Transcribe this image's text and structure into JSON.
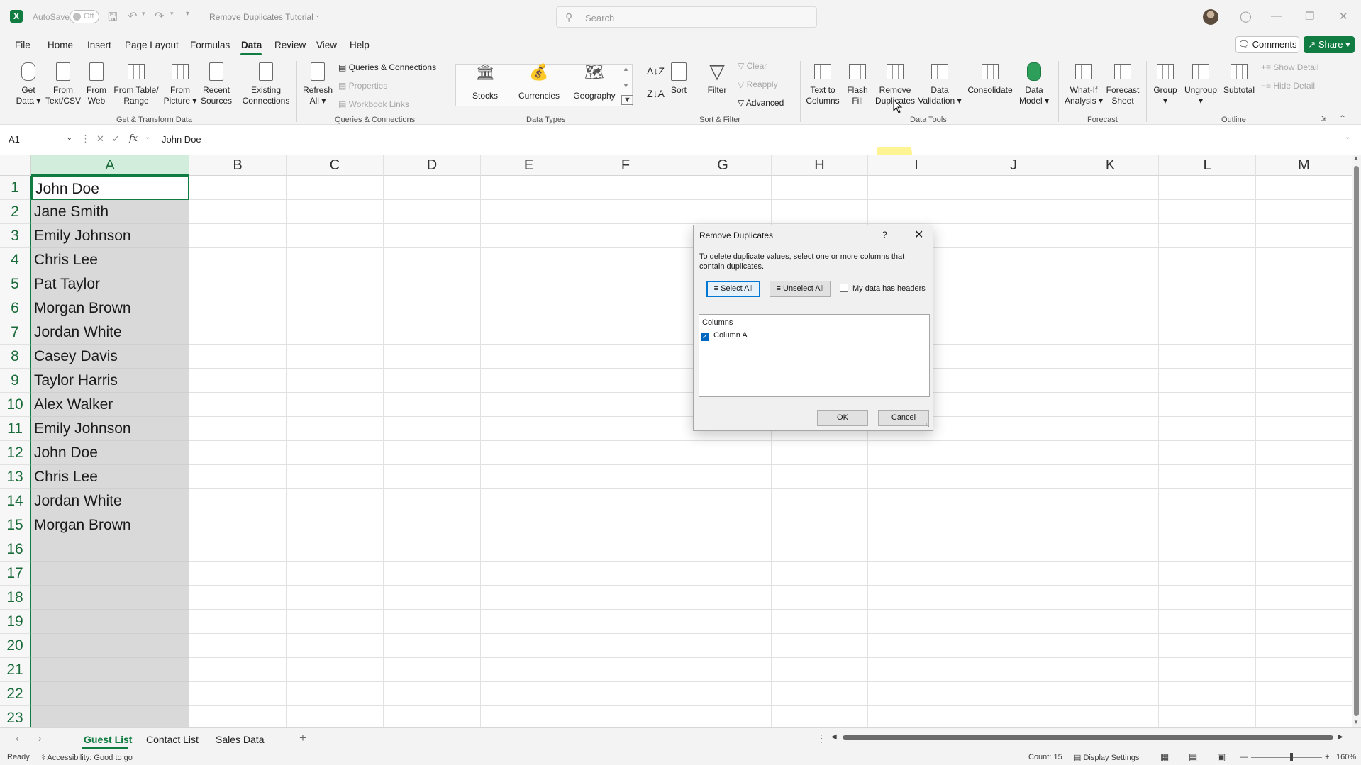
{
  "titlebar": {
    "autosave_label": "AutoSave",
    "autosave_state": "Off",
    "document_title": "Remove Duplicates Tutorial",
    "search_placeholder": "Search"
  },
  "menu": {
    "tabs": [
      "File",
      "Home",
      "Insert",
      "Page Layout",
      "Formulas",
      "Data",
      "Review",
      "View",
      "Help"
    ],
    "active_tab": "Data",
    "comments_label": "Comments",
    "share_label": "Share"
  },
  "ribbon": {
    "get_transform": {
      "label": "Get & Transform Data",
      "get_data": [
        "Get",
        "Data"
      ],
      "from_text_csv": [
        "From",
        "Text/CSV"
      ],
      "from_web": [
        "From",
        "Web"
      ],
      "from_table_range": [
        "From Table/",
        "Range"
      ],
      "from_picture": [
        "From",
        "Picture"
      ],
      "recent_sources": [
        "Recent",
        "Sources"
      ],
      "existing_connections": [
        "Existing",
        "Connections"
      ]
    },
    "queries": {
      "label": "Queries & Connections",
      "refresh_all": [
        "Refresh",
        "All"
      ],
      "queries_connections": "Queries & Connections",
      "properties": "Properties",
      "workbook_links": "Workbook Links"
    },
    "data_types": {
      "label": "Data Types",
      "stocks": "Stocks",
      "currencies": "Currencies",
      "geography": "Geography"
    },
    "sort_filter": {
      "label": "Sort & Filter",
      "sort": "Sort",
      "filter": "Filter",
      "clear": "Clear",
      "reapply": "Reapply",
      "advanced": "Advanced"
    },
    "data_tools": {
      "label": "Data Tools",
      "text_to_columns": [
        "Text to",
        "Columns"
      ],
      "flash_fill": [
        "Flash",
        "Fill"
      ],
      "remove_duplicates": [
        "Remove",
        "Duplicates"
      ],
      "data_validation": [
        "Data",
        "Validation"
      ],
      "consolidate": "Consolidate",
      "data_model": [
        "Data",
        "Model"
      ]
    },
    "forecast": {
      "label": "Forecast",
      "what_if": [
        "What-If",
        "Analysis"
      ],
      "forecast_sheet": [
        "Forecast",
        "Sheet"
      ]
    },
    "outline": {
      "label": "Outline",
      "group": "Group",
      "ungroup": "Ungroup",
      "subtotal": "Subtotal",
      "show_detail": "Show Detail",
      "hide_detail": "Hide Detail"
    }
  },
  "formula_bar": {
    "name_box": "A1",
    "fx": "fx",
    "content": "John Doe"
  },
  "grid": {
    "columns": [
      "A",
      "B",
      "C",
      "D",
      "E",
      "F",
      "G",
      "H",
      "I",
      "J",
      "K",
      "L",
      "M"
    ],
    "rows": [
      "1",
      "2",
      "3",
      "4",
      "5",
      "6",
      "7",
      "8",
      "9",
      "10",
      "11",
      "12",
      "13",
      "14",
      "15",
      "16",
      "17",
      "18",
      "19",
      "20",
      "21",
      "22",
      "23"
    ],
    "column_a": [
      "John Doe",
      "Jane Smith",
      "Emily Johnson",
      "Chris Lee",
      "Pat Taylor",
      "Morgan Brown",
      "Jordan White",
      "Casey Davis",
      "Taylor Harris",
      "Alex Walker",
      "Emily Johnson",
      "John Doe",
      "Chris Lee",
      "Jordan White",
      "Morgan Brown",
      "",
      "",
      "",
      "",
      "",
      "",
      "",
      ""
    ]
  },
  "dialog": {
    "title": "Remove Duplicates",
    "help": "?",
    "description": "To delete duplicate values, select one or more columns that contain duplicates.",
    "select_all": "Select All",
    "unselect_all": "Unselect All",
    "headers_checkbox": "My data has headers",
    "headers_checked": false,
    "list_header": "Columns",
    "list_items": [
      {
        "label": "Column A",
        "checked": true
      }
    ],
    "ok": "OK",
    "cancel": "Cancel"
  },
  "sheets": {
    "tabs": [
      "Guest List",
      "Contact List",
      "Sales Data"
    ],
    "active": "Guest List"
  },
  "status": {
    "ready": "Ready",
    "accessibility": "Accessibility: Good to go",
    "count": "Count: 15",
    "display_settings": "Display Settings",
    "zoom": "160%"
  },
  "colors": {
    "accent": "#107c41",
    "selection_fill": "#d9d9d9",
    "dialog_check": "#0067c0"
  }
}
